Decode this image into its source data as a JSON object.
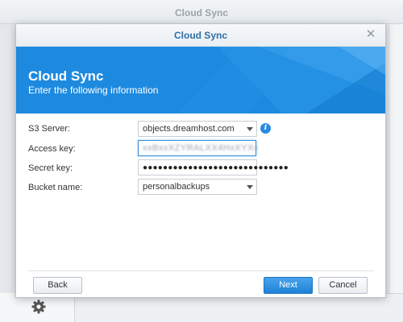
{
  "background": {
    "title": "Cloud Sync",
    "gear_icon": "gear-icon"
  },
  "dialog": {
    "title": "Cloud Sync",
    "close_icon": "close-icon",
    "banner": {
      "title": "Cloud Sync",
      "subtitle": "Enter the following information",
      "color": "#1d8ae0"
    },
    "form": {
      "s3_server": {
        "label": "S3 Server:",
        "value": "objects.dreamhost.com"
      },
      "access_key": {
        "label": "Access key:",
        "value": "xxBxxXZYRALXX4HxXYXx"
      },
      "secret_key": {
        "label": "Secret key:",
        "value": "●●●●●●●●●●●●●●●●●●●●●●●●●●●●●"
      },
      "bucket_name": {
        "label": "Bucket name:",
        "value": "personalbackups"
      }
    },
    "buttons": {
      "back": "Back",
      "next": "Next",
      "cancel": "Cancel"
    }
  }
}
